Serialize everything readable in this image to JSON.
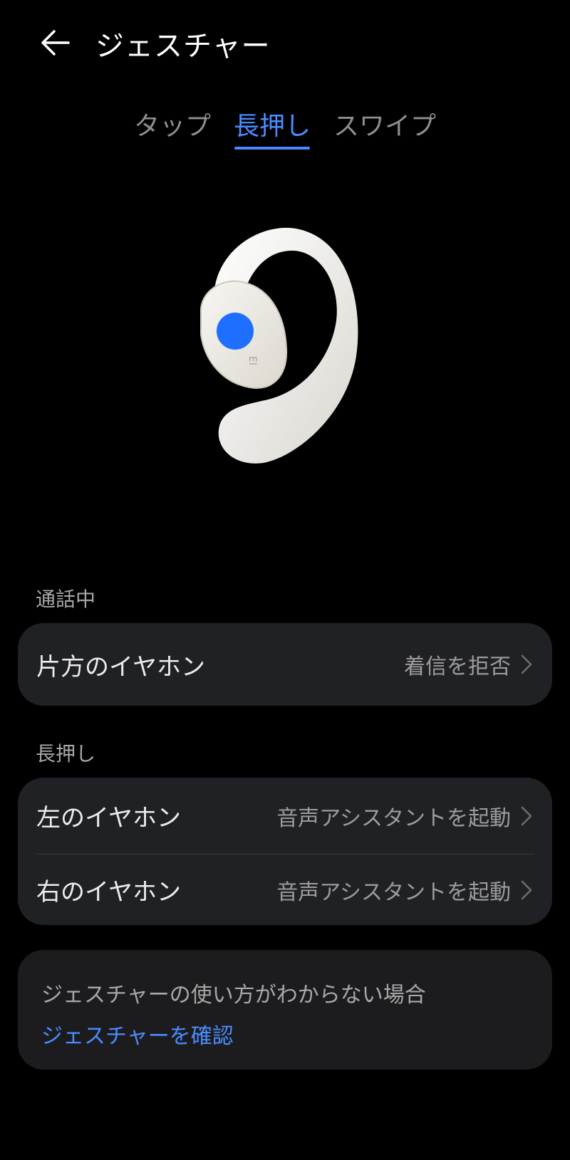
{
  "header": {
    "title": "ジェスチャー",
    "back_icon": "arrow-left-icon"
  },
  "tabs": [
    {
      "label": "タップ",
      "active": false
    },
    {
      "label": "長押し",
      "active": true
    },
    {
      "label": "スワイプ",
      "active": false
    }
  ],
  "colors": {
    "accent": "#4a8cff",
    "card_bg": "#202124",
    "background": "#000000",
    "touch_dot": "#1f6fff"
  },
  "illustration": {
    "icon": "earbud-illustration",
    "brand_text": "EI"
  },
  "during_call": {
    "section_label": "通話中",
    "rows": [
      {
        "label": "片方のイヤホン",
        "value": "着信を拒否"
      }
    ]
  },
  "long_press": {
    "section_label": "長押し",
    "rows": [
      {
        "label": "左のイヤホン",
        "value": "音声アシスタントを起動"
      },
      {
        "label": "右のイヤホン",
        "value": "音声アシスタントを起動"
      }
    ]
  },
  "help": {
    "text": "ジェスチャーの使い方がわからない場合",
    "link": "ジェスチャーを確認"
  }
}
